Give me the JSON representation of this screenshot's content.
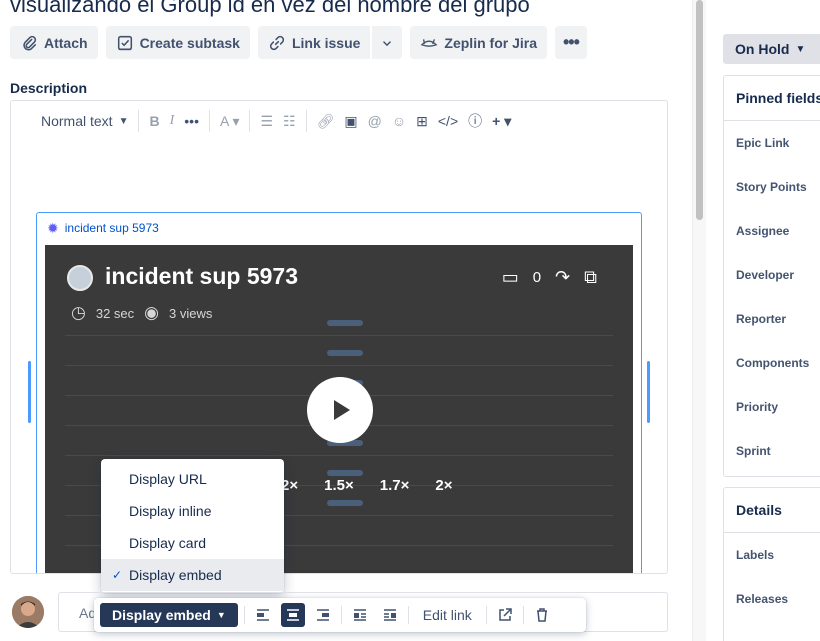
{
  "issue": {
    "title": "visualizando el Group id en vez del nombre del grupo"
  },
  "toolbar": {
    "attach": "Attach",
    "create_subtask": "Create subtask",
    "link_issue": "Link issue",
    "zeplin": "Zeplin for Jira"
  },
  "description": {
    "label": "Description",
    "text_style": "Normal text"
  },
  "embed": {
    "link_title": "incident sup 5973",
    "video_title": "incident sup 5973",
    "duration": "32 sec",
    "views": "3 views",
    "comments": "0",
    "speeds": [
      "2×",
      "1.5×",
      "1.7×",
      "2×"
    ]
  },
  "display_menu": {
    "items": [
      "Display URL",
      "Display inline",
      "Display card",
      "Display embed"
    ],
    "selected": "Display embed"
  },
  "floating_toolbar": {
    "display_button": "Display embed",
    "edit_link": "Edit link"
  },
  "comment": {
    "placeholder": "Ad"
  },
  "sidebar": {
    "status": "On Hold",
    "pinned_title": "Pinned fields",
    "pinned_fields": [
      "Epic Link",
      "Story Points",
      "Assignee",
      "Developer",
      "Reporter",
      "Components",
      "Priority",
      "Sprint"
    ],
    "details_title": "Details",
    "details_fields": [
      "Labels",
      "Releases"
    ]
  }
}
